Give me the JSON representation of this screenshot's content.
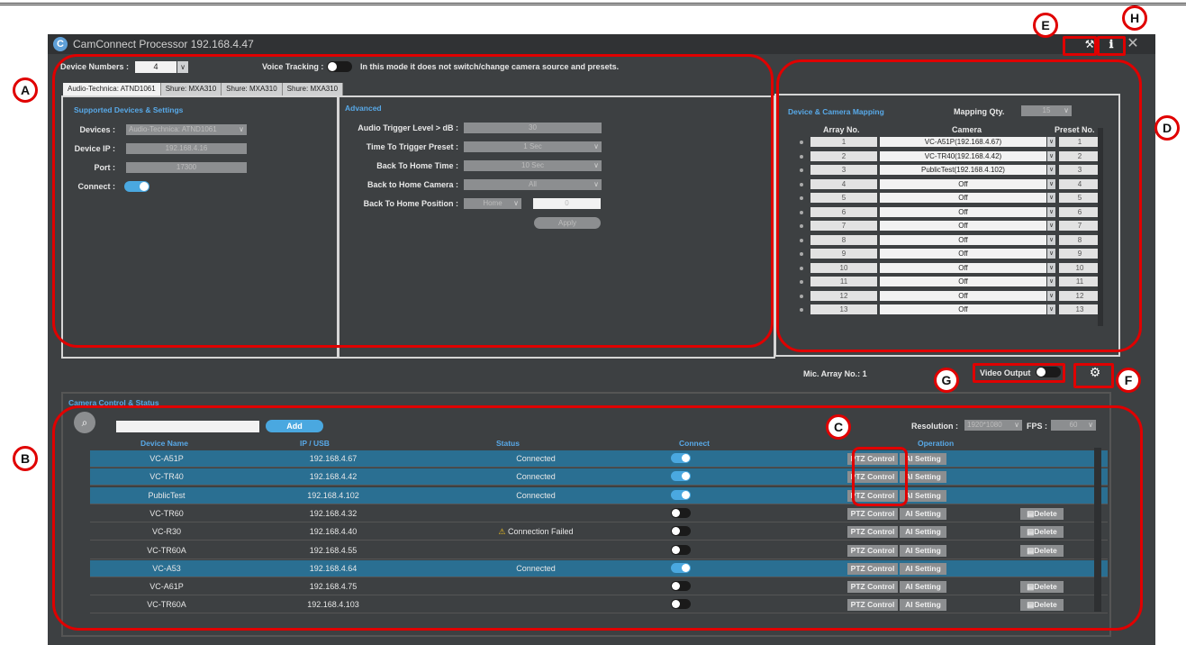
{
  "window": {
    "title": "CamConnect Processor 192.168.4.47",
    "logo": "C",
    "tools_icon": "wrench-icon",
    "info_icon": "info-icon",
    "close_icon": "close-icon"
  },
  "top": {
    "device_numbers_label": "Device Numbers :",
    "device_numbers_value": "4",
    "voice_tracking_label": "Voice Tracking :",
    "voice_tracking_on": false,
    "voice_tracking_note": "In this mode it does not switch/change camera source and presets."
  },
  "tabs": [
    "Audio-Technica: ATND1061",
    "Shure: MXA310",
    "Shure: MXA310",
    "Shure: MXA310"
  ],
  "supported": {
    "title": "Supported Devices & Settings",
    "devices_label": "Devices :",
    "devices_value": "Audio-Technica: ATND1061",
    "ip_label": "Device IP :",
    "ip_value": "192.168.4.16",
    "port_label": "Port :",
    "port_value": "17300",
    "connect_label": "Connect :",
    "connect_on": true
  },
  "advanced": {
    "title": "Advanced",
    "trigger_label": "Audio Trigger Level > dB :",
    "trigger_value": "30",
    "time_label": "Time To Trigger Preset :",
    "time_value": "1 Sec",
    "home_time_label": "Back To Home Time :",
    "home_time_value": "10 Sec",
    "home_camera_label": "Back to Home Camera :",
    "home_camera_value": "All",
    "home_pos_label": "Back To Home Position :",
    "home_pos_value": "Home",
    "home_pos_num": "0",
    "apply_label": "Apply"
  },
  "mapping": {
    "title": "Device & Camera Mapping",
    "qty_label": "Mapping Qty.",
    "qty_value": "15",
    "col_array": "Array No.",
    "col_camera": "Camera",
    "col_preset": "Preset No.",
    "rows": [
      {
        "array": "1",
        "camera": "VC-A51P(192.168.4.67)",
        "preset": "1"
      },
      {
        "array": "2",
        "camera": "VC-TR40(192.168.4.42)",
        "preset": "2"
      },
      {
        "array": "3",
        "camera": "PublicTest(192.168.4.102)",
        "preset": "3"
      },
      {
        "array": "4",
        "camera": "Off",
        "preset": "4"
      },
      {
        "array": "5",
        "camera": "Off",
        "preset": "5"
      },
      {
        "array": "6",
        "camera": "Off",
        "preset": "6"
      },
      {
        "array": "7",
        "camera": "Off",
        "preset": "7"
      },
      {
        "array": "8",
        "camera": "Off",
        "preset": "8"
      },
      {
        "array": "9",
        "camera": "Off",
        "preset": "9"
      },
      {
        "array": "10",
        "camera": "Off",
        "preset": "10"
      },
      {
        "array": "11",
        "camera": "Off",
        "preset": "11"
      },
      {
        "array": "12",
        "camera": "Off",
        "preset": "12"
      },
      {
        "array": "13",
        "camera": "Off",
        "preset": "13"
      }
    ],
    "mic_array": "Mic. Array No.: 1"
  },
  "video_output": {
    "label": "Video Output",
    "on": false,
    "settings_icon": "gear-icon"
  },
  "camera": {
    "title": "Camera Control & Status",
    "search_icon": "search-icon",
    "add_label": "Add",
    "resolution_label": "Resolution :",
    "resolution_value": "1920*1080",
    "fps_label": "FPS :",
    "fps_value": "60",
    "headers": {
      "name": "Device Name",
      "ip": "IP / USB",
      "status": "Status",
      "connect": "Connect",
      "operation": "Operation"
    },
    "ptz_label": "PTZ Control",
    "ai_label": "AI Setting",
    "delete_label": "Delete",
    "warn_icon": "warning-icon",
    "trash_icon": "trash-icon",
    "rows": [
      {
        "name": "VC-A51P",
        "ip": "192.168.4.67",
        "status": "Connected",
        "connected": true,
        "deletable": false
      },
      {
        "name": "VC-TR40",
        "ip": "192.168.4.42",
        "status": "Connected",
        "connected": true,
        "deletable": false
      },
      {
        "name": "PublicTest",
        "ip": "192.168.4.102",
        "status": "Connected",
        "connected": true,
        "deletable": false
      },
      {
        "name": "VC-TR60",
        "ip": "192.168.4.32",
        "status": "",
        "connected": false,
        "deletable": true
      },
      {
        "name": "VC-R30",
        "ip": "192.168.4.40",
        "status": "Connection Failed",
        "connected": false,
        "deletable": true,
        "warning": true
      },
      {
        "name": "VC-TR60A",
        "ip": "192.168.4.55",
        "status": "",
        "connected": false,
        "deletable": true
      },
      {
        "name": "VC-A53",
        "ip": "192.168.4.64",
        "status": "Connected",
        "connected": true,
        "deletable": false
      },
      {
        "name": "VC-A61P",
        "ip": "192.168.4.75",
        "status": "",
        "connected": false,
        "deletable": true
      },
      {
        "name": "VC-TR60A",
        "ip": "192.168.4.103",
        "status": "",
        "connected": false,
        "deletable": true
      }
    ]
  },
  "annotations": {
    "A": "A",
    "B": "B",
    "C": "C",
    "D": "D",
    "E": "E",
    "F": "F",
    "G": "G",
    "H": "H"
  }
}
